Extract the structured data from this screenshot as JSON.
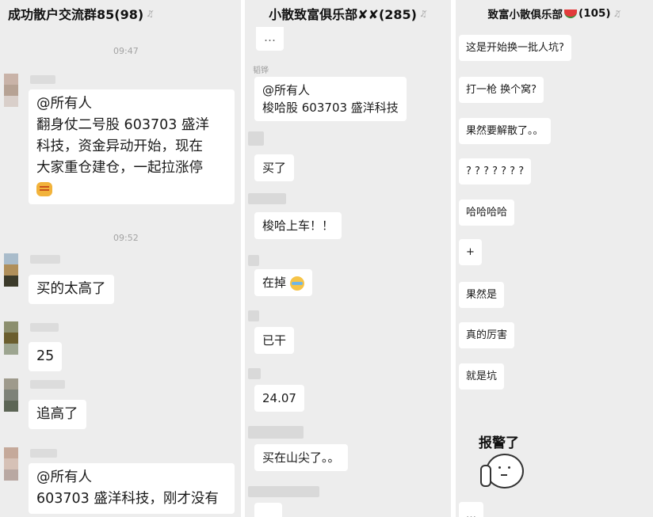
{
  "chats": [
    {
      "title": "成功散户交流群85(98)",
      "bell_icon": "bell-off-icon",
      "timestamps": [
        "09:47",
        "09:52"
      ],
      "messages": [
        {
          "lines": [
            "@所有人",
            "翻身仗二号股  603703 盛洋",
            "科技，资金异动开始，现在",
            "大家重仓建仓，一起拉涨停"
          ],
          "emoji": "fist-emoji"
        },
        {
          "text": "买的太高了"
        },
        {
          "text": "25"
        },
        {
          "text": "追高了"
        },
        {
          "lines": [
            "@所有人",
            "603703 盛洋科技，刚才没有"
          ]
        }
      ]
    },
    {
      "title": "小散致富俱乐部✘✘(285)",
      "bell_icon": "bell-off-icon",
      "top_partial": "…",
      "sender_name": "韬铧",
      "messages": [
        {
          "lines": [
            "@所有人",
            "梭哈股 603703 盛洋科技"
          ]
        },
        {
          "text": "买了"
        },
        {
          "text": "梭哈上车！！"
        },
        {
          "text": "在掉",
          "emoji": "sob-emoji"
        },
        {
          "text": "已干"
        },
        {
          "text": "24.07"
        },
        {
          "text": "买在山尖了。。"
        },
        {
          "text": "…"
        }
      ]
    },
    {
      "title": "致富小散俱乐部",
      "title_count": "(105)",
      "title_icon": "watermelon-icon",
      "bell_icon": "bell-off-icon",
      "messages": [
        {
          "text": "这是开始换一批人坑?"
        },
        {
          "text": "打一枪 换个窝?"
        },
        {
          "text": "果然要解散了。。"
        },
        {
          "text": "? ? ? ? ? ? ?"
        },
        {
          "text": "哈哈哈哈"
        },
        {
          "text": "+"
        },
        {
          "text": "果然是"
        },
        {
          "text": "真的厉害"
        },
        {
          "text": "就是坑"
        }
      ],
      "sticker": {
        "label": "报警了",
        "icon": "phone-call-sticker"
      },
      "bottom_partial": "…"
    }
  ],
  "colors": {
    "bubble": "#ffffff",
    "background": "#ededed",
    "timestamp": "#a3a3a3"
  }
}
